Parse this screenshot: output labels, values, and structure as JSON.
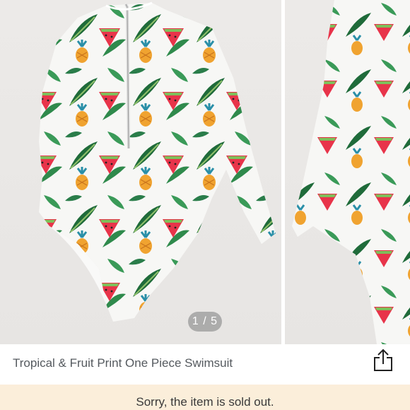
{
  "gallery": {
    "counter": "1 / 5",
    "main_image": "tropical-fruit-swimsuit-front",
    "next_image": "tropical-fruit-swimsuit-detail"
  },
  "product": {
    "title": "Tropical & Fruit Print One Piece Swimsuit"
  },
  "share": {
    "icon": "share-icon"
  },
  "banner": {
    "message": "Sorry, the item is sold out."
  },
  "colors": {
    "banner_bg": "#fbeeda",
    "counter_bg": "#969696",
    "title_text": "#555a5f",
    "photo_bg": "#eceae8"
  }
}
